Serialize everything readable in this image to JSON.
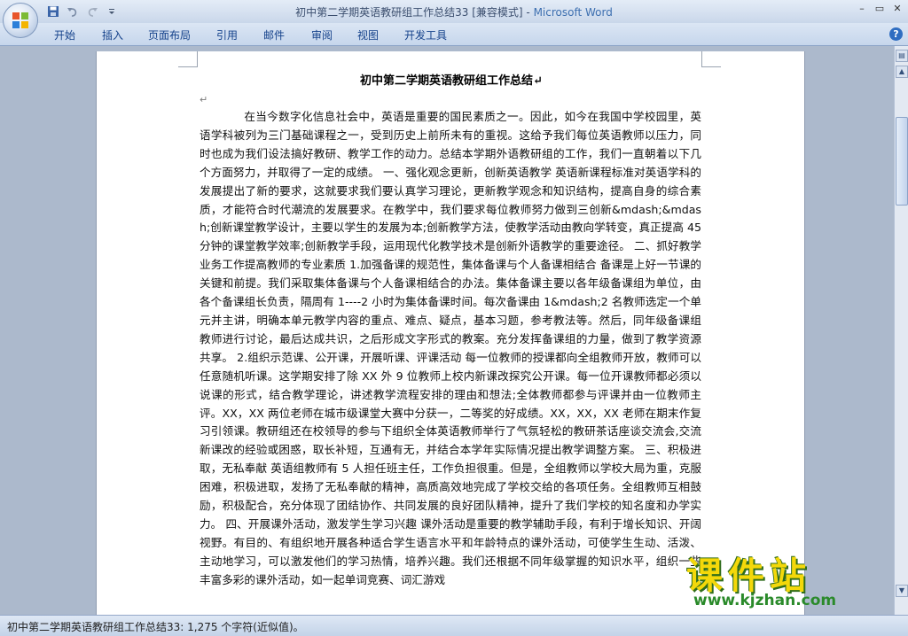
{
  "window": {
    "title_doc": "初中第二学期英语教研组工作总结33 [兼容模式] - ",
    "title_app": "Microsoft Word",
    "controls": [
      "–",
      "▭",
      "✕"
    ]
  },
  "ribbon": {
    "tabs": [
      "开始",
      "插入",
      "页面布局",
      "引用",
      "邮件",
      "审阅",
      "视图",
      "开发工具"
    ],
    "help": "?"
  },
  "document": {
    "title": "初中第二学期英语教研组工作总结↵",
    "empty_para": "↵",
    "body": "在当今数字化信息社会中，英语是重要的国民素质之一。因此，如今在我国中学校园里，英语学科被列为三门基础课程之一，受到历史上前所未有的重视。这给予我们每位英语教师以压力，同时也成为我们设法搞好教研、教学工作的动力。总结本学期外语教研组的工作，我们一直朝着以下几个方面努力，并取得了一定的成绩。 一、强化观念更新，创新英语教学 英语新课程标准对英语学科的发展提出了新的要求，这就要求我们要认真学习理论，更新教学观念和知识结构，提高自身的综合素质，才能符合时代潮流的发展要求。在教学中，我们要求每位教师努力做到三创新&mdash;&mdash;创新课堂教学设计，主要以学生的发展为本;创新教学方法，使教学活动由教向学转变，真正提高 45 分钟的课堂教学效率;创新教学手段，运用现代化教学技术是创新外语教学的重要途径。 二、抓好教学业务工作提高教师的专业素质 1.加强备课的规范性，集体备课与个人备课相结合 备课是上好一节课的关键和前提。我们采取集体备课与个人备课相结合的办法。集体备课主要以各年级备课组为单位，由各个备课组长负责，隔周有 1----2 小时为集体备课时间。每次备课由 1&mdash;2 名教师选定一个单元并主讲，明确本单元教学内容的重点、难点、疑点，基本习题，参考教法等。然后，同年级备课组教师进行讨论，最后达成共识，之后形成文字形式的教案。充分发挥备课组的力量，做到了教学资源共享。 2.组织示范课、公开课，开展听课、评课活动 每一位教师的授课都向全组教师开放，教师可以任意随机听课。这学期安排了除 XX 外 9 位教师上校内新课改探究公开课。每一位开课教师都必须以说课的形式，结合教学理论，讲述教学流程安排的理由和想法;全体教师都参与评课并由一位教师主评。XX，XX 两位老师在城市级课堂大赛中分获一，二等奖的好成绩。XX，XX，XX 老师在期末作复习引领课。教研组还在校领导的参与下组织全体英语教师举行了气氛轻松的教研茶话座谈交流会,交流新课改的经验或困惑，取长补短，互通有无，并结合本学年实际情况提出教学调整方案。 三、积极进取，无私奉献 英语组教师有 5 人担任班主任，工作负担很重。但是，全组教师以学校大局为重，克服困难，积极进取，发扬了无私奉献的精神，高质高效地完成了学校交给的各项任务。全组教师互相鼓励，积极配合，充分体现了团结协作、共同发展的良好团队精神，提升了我们学校的知名度和办学实力。 四、开展课外活动，激发学生学习兴趣 课外活动是重要的教学辅助手段，有利于增长知识、开阔视野。有目的、有组织地开展各种适合学生语言水平和年龄特点的课外活动，可使学生生动、活泼、主动地学习，可以激发他们的学习热情，培养兴趣。我们还根据不同年级掌握的知识水平，组织一些丰富多彩的课外活动，如一起单词竞赛、词汇游戏"
  },
  "status": {
    "text": "初中第二学期英语教研组工作总结33: 1,275 个字符(近似值)。"
  },
  "watermark": {
    "title": "课件站",
    "url": "www.kjzhan.com"
  },
  "colors": {
    "app_title": "#3d6fb0",
    "tab_text": "#15428b",
    "watermark_fill": "#f4d80a",
    "watermark_url": "#2a8a2a"
  },
  "icons": [
    "office-logo-icon",
    "save-icon",
    "undo-icon",
    "redo-icon",
    "customize-qat-icon",
    "help-icon",
    "ruler-toggle-icon",
    "scroll-up-icon",
    "scroll-down-icon"
  ]
}
